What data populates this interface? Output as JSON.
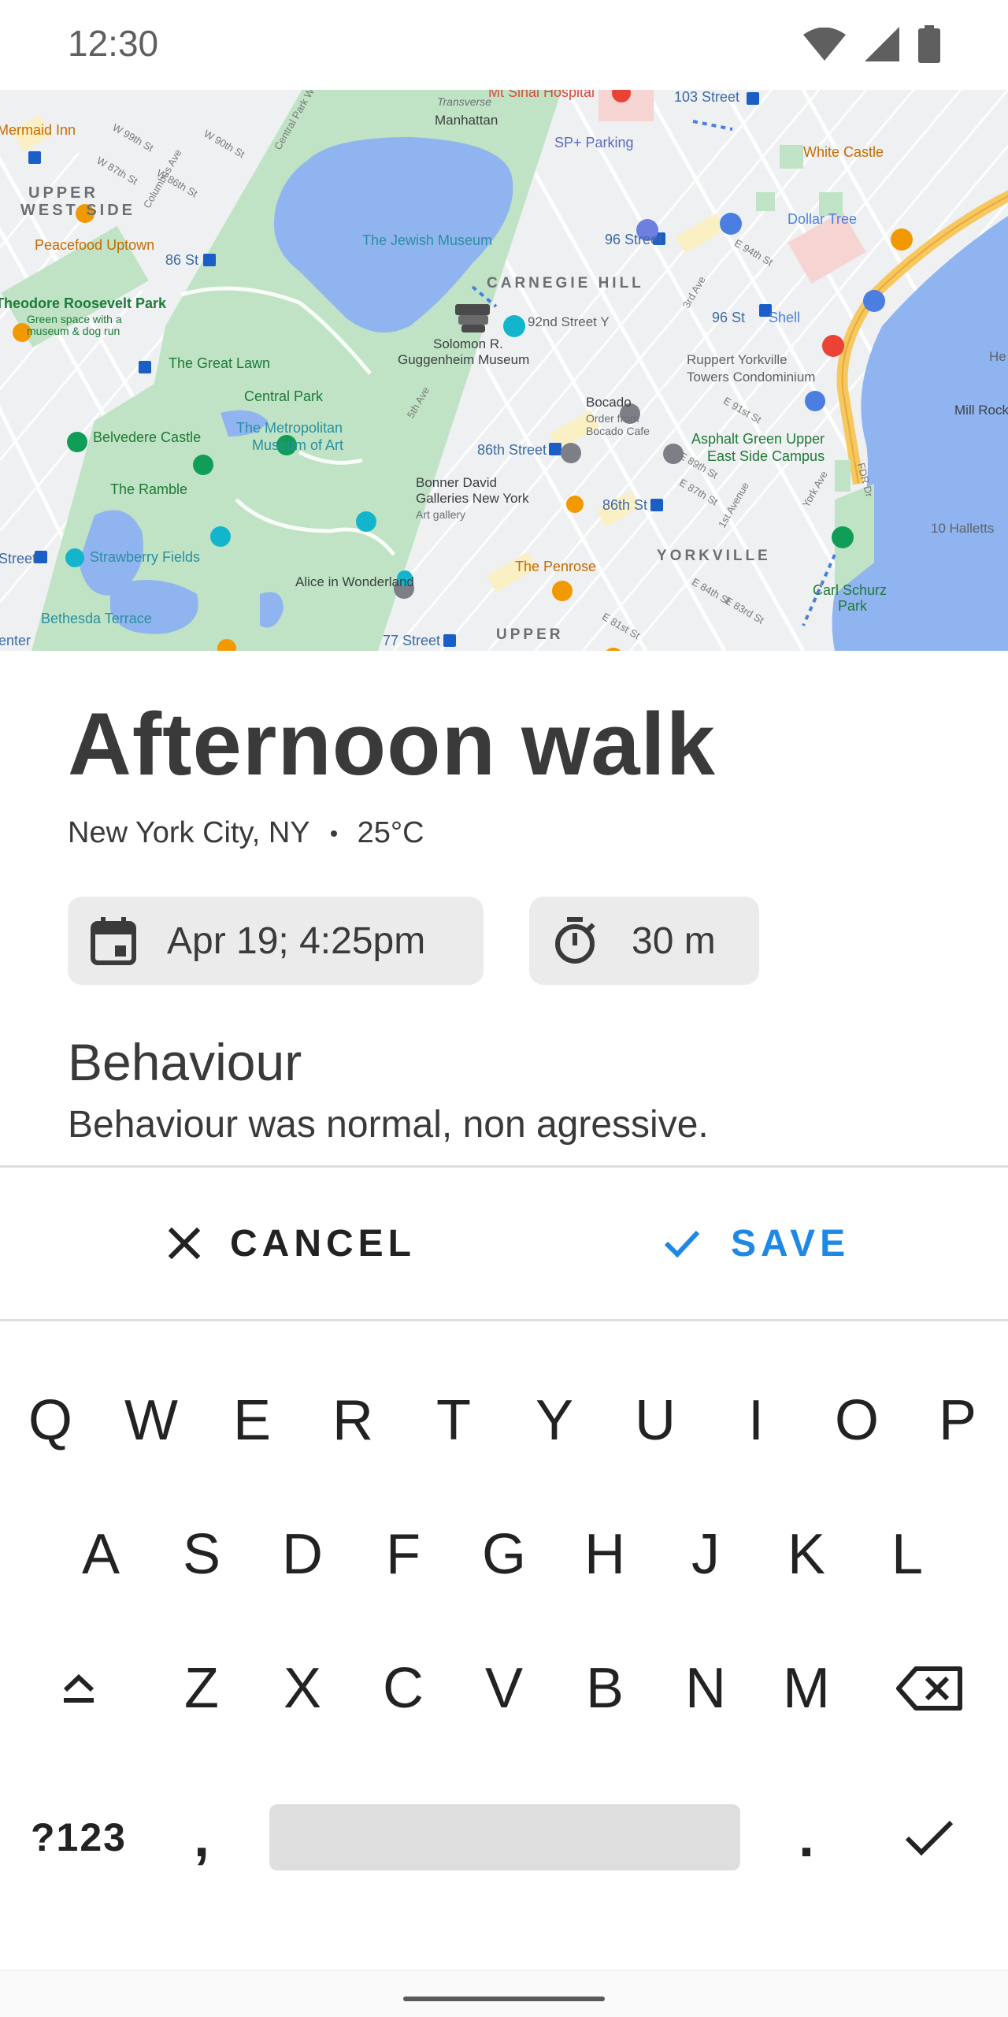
{
  "status_bar": {
    "time": "12:30",
    "icons": [
      "wifi-icon",
      "cellular-signal-icon",
      "battery-icon"
    ]
  },
  "map": {
    "labels": {
      "hospital": "Mt Sinai Hospital",
      "manhattan": "Manhattan",
      "transverse": "Transverse",
      "st_103": "103 Street",
      "mermaid_inn": "Mermaid Inn",
      "w99": "W 99th St",
      "w90": "W 90th St",
      "w87": "W 87th St",
      "w86": "W 86th St",
      "sp_parking": "SP+ Parking",
      "white_castle": "White Castle",
      "upper_west_side_1": "UPPER",
      "upper_west_side_2": "WEST SIDE",
      "columbus": "Columbus Ave",
      "central_park_w": "Central Park W",
      "peacefood": "Peacefood Uptown",
      "jewish_museum": "The Jewish Museum",
      "st_96": "96 Street",
      "dollar_tree": "Dollar Tree",
      "st_86_left": "86 St",
      "carnegie_hill": "CARNEGIE HILL",
      "roosevelt_park": "Theodore Roosevelt Park",
      "roosevelt_desc": "Green space with a museum & dog run",
      "great_lawn": "The Great Lawn",
      "st_92y": "92nd Street Y",
      "st_96_right": "96 St",
      "shell": "Shell",
      "guggenheim_1": "Solomon R.",
      "guggenheim_2": "Guggenheim Museum",
      "ruppert_1": "Ruppert Yorkville",
      "ruppert_2": "Towers Condominium",
      "central_park": "Central Park",
      "mill_rock": "Mill Rock",
      "belvedere": "Belvedere Castle",
      "met_1": "The Metropolitan",
      "met_2": "Museum of Art",
      "bocado_1": "Bocado",
      "bocado_2": "Order from",
      "bocado_3": "Bocado Cafe",
      "asphalt_1": "Asphalt Green Upper",
      "asphalt_2": "East Side Campus",
      "st_86_mid": "86th Street",
      "ramble": "The Ramble",
      "bonner_1": "Bonner David",
      "bonner_2": "Galleries New York",
      "bonner_3": "Art gallery",
      "st_86_right": "86th St",
      "fdr": "FDR Dr",
      "ten_halletts": "10 Halletts",
      "strawberry": "Strawberry Fields",
      "street_left": "Street",
      "penrose": "The Penrose",
      "yorkville": "YORKVILLE",
      "alice": "Alice in Wonderland",
      "carl_schurz_1": "Carl Schurz",
      "carl_schurz_2": "Park",
      "bethesda": "Bethesda Terrace",
      "enter": "enter",
      "st_77": "77 Street",
      "upper_east": "UPPER",
      "e_94": "E 94th St",
      "e_91": "E 91st St",
      "e_89": "E 89th St",
      "e_87": "E 87th St",
      "e_84": "E 84th St",
      "e_83": "E 83rd St",
      "e_81": "E 81st St",
      "third_ave": "3rd Ave",
      "first_ave": "1st Avenue",
      "fifth_ave": "5th Ave",
      "york_ave": "York Ave",
      "he": "He"
    }
  },
  "walk": {
    "title": "Afternoon walk",
    "location": "New York City, NY",
    "temperature": "25°C",
    "date_time": "Apr 19; 4:25pm",
    "duration": "30 m",
    "section_title": "Behaviour",
    "section_body": "Behaviour was normal, non agressive."
  },
  "actions": {
    "cancel_label": "CANCEL",
    "save_label": "SAVE"
  },
  "colors": {
    "accent": "#1e88e5",
    "text": "#3a3a3a",
    "chip_bg": "#ebebeb",
    "map_water": "#90b4f0",
    "map_park": "#bfe3c4",
    "map_highway": "#f6c85f"
  },
  "keyboard": {
    "row1": [
      "Q",
      "W",
      "E",
      "R",
      "T",
      "Y",
      "U",
      "I",
      "O",
      "P"
    ],
    "row2": [
      "A",
      "S",
      "D",
      "F",
      "G",
      "H",
      "J",
      "K",
      "L"
    ],
    "row3": [
      "Z",
      "X",
      "C",
      "V",
      "B",
      "N",
      "M"
    ],
    "symbols_label": "?123",
    "comma": ",",
    "period": "."
  }
}
